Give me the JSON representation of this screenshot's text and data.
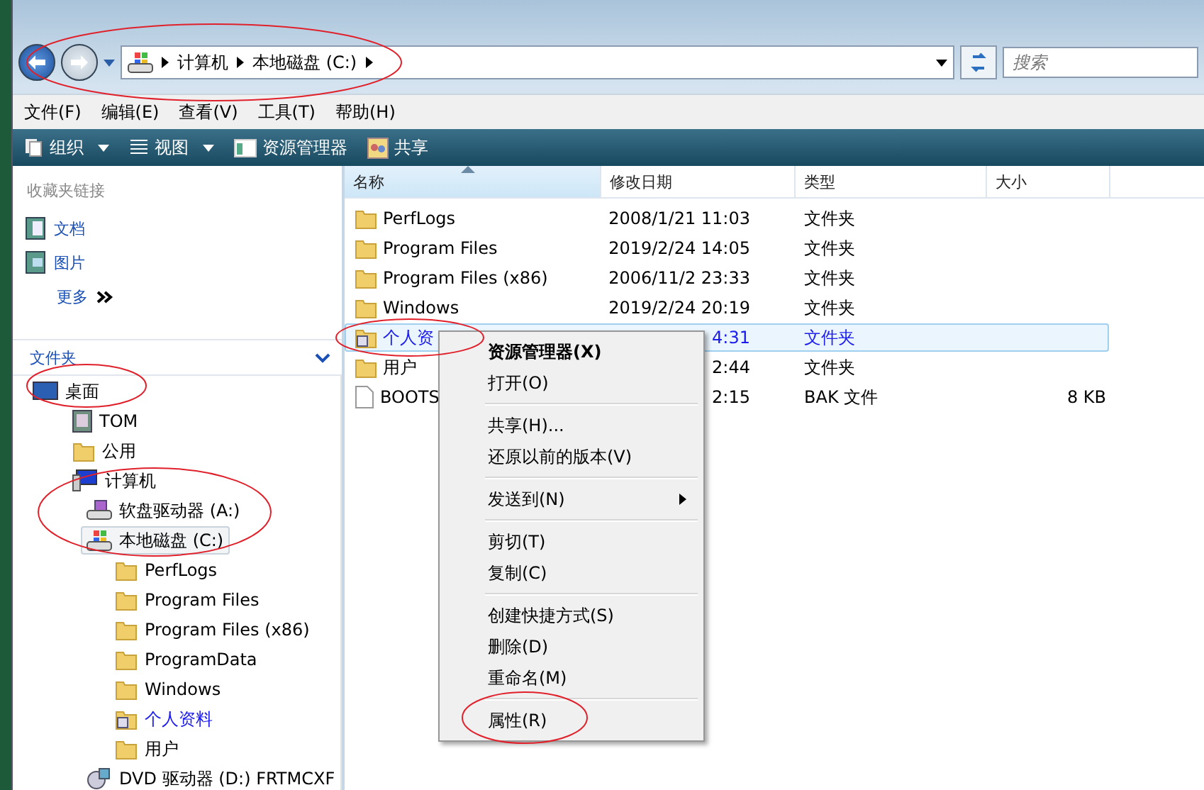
{
  "address": {
    "crumbs": [
      "计算机",
      "本地磁盘 (C:)"
    ],
    "search_placeholder": "搜索"
  },
  "menu_bar": [
    "文件(F)",
    "编辑(E)",
    "查看(V)",
    "工具(T)",
    "帮助(H)"
  ],
  "toolbar": [
    {
      "label": "组织",
      "kind": "organize",
      "dropdown": true
    },
    {
      "label": "视图",
      "kind": "views",
      "dropdown": true
    },
    {
      "label": "资源管理器",
      "kind": "explorer",
      "dropdown": false
    },
    {
      "label": "共享",
      "kind": "share",
      "dropdown": false
    }
  ],
  "favorites": {
    "title": "收藏夹链接",
    "items": [
      {
        "label": "文档",
        "kind": "doc"
      },
      {
        "label": "图片",
        "kind": "pic"
      },
      {
        "label": "更多",
        "kind": "more"
      }
    ]
  },
  "folders": {
    "title": "文件夹",
    "tree": [
      {
        "label": "桌面",
        "kind": "desktop",
        "selected": false,
        "children": [
          {
            "label": "TOM",
            "kind": "user",
            "selected": false
          },
          {
            "label": "公用",
            "kind": "folder",
            "selected": false
          },
          {
            "label": "计算机",
            "kind": "computer",
            "selected": false,
            "children": [
              {
                "label": "软盘驱动器 (A:)",
                "kind": "floppy",
                "selected": false
              },
              {
                "label": "本地磁盘 (C:)",
                "kind": "drive",
                "selected": true,
                "children": [
                  {
                    "label": "PerfLogs",
                    "kind": "folder",
                    "selected": false
                  },
                  {
                    "label": "Program Files",
                    "kind": "folder",
                    "selected": false
                  },
                  {
                    "label": "Program Files (x86)",
                    "kind": "folder",
                    "selected": false
                  },
                  {
                    "label": "ProgramData",
                    "kind": "folder",
                    "selected": false
                  },
                  {
                    "label": "Windows",
                    "kind": "folder",
                    "selected": false
                  },
                  {
                    "label": "个人资料",
                    "kind": "profile",
                    "selected": false
                  },
                  {
                    "label": "用户",
                    "kind": "folder",
                    "selected": false
                  }
                ]
              },
              {
                "label": "DVD 驱动器 (D:) FRTMCXF",
                "kind": "dvd",
                "selected": false
              }
            ]
          }
        ]
      }
    ]
  },
  "table": {
    "columns": [
      {
        "label": "名称",
        "sorted": true
      },
      {
        "label": "修改日期",
        "sorted": false
      },
      {
        "label": "类型",
        "sorted": false
      },
      {
        "label": "大小",
        "sorted": false
      }
    ],
    "rows": [
      {
        "name": "PerfLogs",
        "kind": "folder",
        "date": "2008/1/21 11:03",
        "type": "文件夹",
        "selected": false
      },
      {
        "name": "Program Files",
        "kind": "folder",
        "date": "2019/2/24 14:05",
        "type": "文件夹",
        "selected": false
      },
      {
        "name": "Program Files (x86)",
        "kind": "folder",
        "date": "2006/11/2 23:33",
        "type": "文件夹",
        "selected": false
      },
      {
        "name": "Windows",
        "kind": "folder",
        "date": "2019/2/24 20:19",
        "type": "文件夹",
        "selected": false
      },
      {
        "name": "个人资",
        "kind": "profile",
        "date": "4:31",
        "type": "文件夹",
        "selected": true
      },
      {
        "name": "用户",
        "kind": "folder",
        "date": "2:44",
        "type": "文件夹",
        "selected": false
      },
      {
        "name": "BOOTS",
        "kind": "file",
        "date": "2:15",
        "type": "BAK 文件",
        "size": "8 KB",
        "selected": false
      }
    ]
  },
  "context_menu": [
    [
      {
        "label": "资源管理器(X)",
        "default": true,
        "submenu": false
      },
      {
        "label": "打开(O)",
        "default": false,
        "submenu": false
      }
    ],
    [
      {
        "label": "共享(H)...",
        "default": false,
        "submenu": false
      },
      {
        "label": "还原以前的版本(V)",
        "default": false,
        "submenu": false
      }
    ],
    [
      {
        "label": "发送到(N)",
        "default": false,
        "submenu": true
      }
    ],
    [
      {
        "label": "剪切(T)",
        "default": false,
        "submenu": false
      },
      {
        "label": "复制(C)",
        "default": false,
        "submenu": false
      }
    ],
    [
      {
        "label": "创建快捷方式(S)",
        "default": false,
        "submenu": false
      },
      {
        "label": "删除(D)",
        "default": false,
        "submenu": false
      },
      {
        "label": "重命名(M)",
        "default": false,
        "submenu": false
      }
    ],
    [
      {
        "label": "属性(R)",
        "default": false,
        "submenu": false
      }
    ]
  ]
}
